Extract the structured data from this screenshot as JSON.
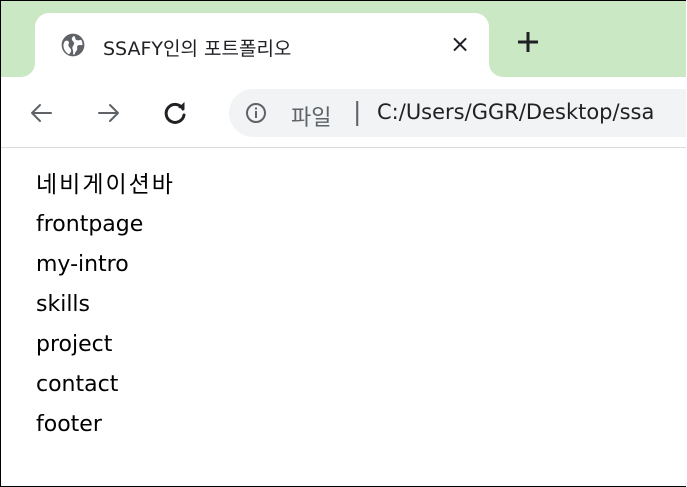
{
  "tab": {
    "favicon_icon": "globe-icon",
    "title": "SSAFY인의 포트폴리오",
    "close_glyph": "×",
    "new_tab_icon": "plus-icon"
  },
  "toolbar": {
    "back_icon": "arrow-left-icon",
    "forward_icon": "arrow-right-icon",
    "reload_icon": "reload-icon",
    "info_icon": "info-icon",
    "scheme_label": "파일",
    "separator": "|",
    "url": "C:/Users/GGR/Desktop/ssa"
  },
  "page": {
    "heading": "네비게이션바",
    "lines": [
      "frontpage",
      "my-intro",
      "skills",
      "project",
      "contact",
      "footer"
    ]
  },
  "colors": {
    "tabstrip_bg": "#cbe8c4",
    "omnibox_bg": "#f1f3f4",
    "icon_color": "#5f6368",
    "text_color": "#202124"
  }
}
